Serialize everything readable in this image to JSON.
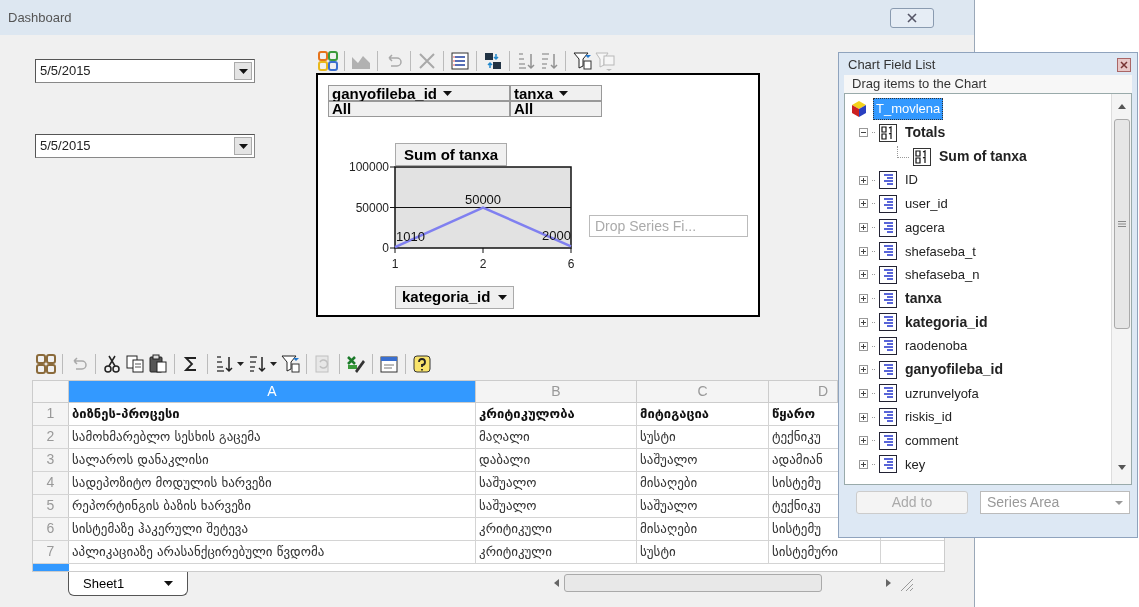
{
  "window": {
    "title": "Dashboard"
  },
  "date_filters": [
    {
      "value": "5/5/2015"
    },
    {
      "value": "5/5/2015"
    }
  ],
  "pivot_chart": {
    "filter_fields": [
      {
        "label": "ganyofileba_id",
        "value": "All"
      },
      {
        "label": "tanxa",
        "value": "All"
      }
    ],
    "drop_zone": {
      "placeholder": "Drop Series Fi..."
    },
    "chart_data": {
      "type": "line",
      "title": "Sum of tanxa",
      "xlabel": "kategoria_id",
      "categories": [
        "1",
        "2",
        "6"
      ],
      "series": [
        {
          "color": "#8080f0",
          "values": [
            1010,
            50000,
            2000
          ]
        }
      ],
      "ylim": [
        0,
        100000
      ],
      "yticks": [
        0,
        50000,
        100000
      ],
      "data_labels": true
    }
  },
  "sheet": {
    "columns": [
      {
        "label": "A",
        "selected": true
      },
      {
        "label": "B",
        "selected": false
      },
      {
        "label": "C",
        "selected": false
      },
      {
        "label": "D",
        "selected": false
      }
    ],
    "rows": [
      {
        "header": "1",
        "bold": true,
        "cells": [
          "ბიზნეს-პროცესი",
          "კრიტიკულობა",
          "მიტიგაცია",
          "წყარო"
        ]
      },
      {
        "header": "2",
        "bold": false,
        "cells": [
          "სამოხმარებლო სესხის გაცემა",
          "მაღალი",
          "სუსტი",
          "ტექნიკუ"
        ]
      },
      {
        "header": "3",
        "bold": false,
        "cells": [
          "სალაროს დანაკლისი",
          "დაბალი",
          "საშუალო",
          "ადამიან"
        ]
      },
      {
        "header": "4",
        "bold": false,
        "cells": [
          "სადეპოზიტო მოდულის ხარვეზი",
          "საშუალო",
          "მისაღები",
          "სისტემუ"
        ]
      },
      {
        "header": "5",
        "bold": false,
        "cells": [
          "რეპორტინგის ბაზის ხარვეზი",
          "საშუალო",
          "საშუალო",
          "ტექნიკუ"
        ]
      },
      {
        "header": "6",
        "bold": false,
        "cells": [
          "სისტემაზე ჰაკერული შეტევა",
          "კრიტიკული",
          "მისაღები",
          "სისტემუ"
        ]
      },
      {
        "header": "7",
        "bold": false,
        "cells": [
          "აპლიკაციაზე არასანქცირებული წვდომა",
          "კრიტიკული",
          "სუსტი",
          "სისტემური"
        ]
      }
    ],
    "tabs": [
      {
        "label": "Sheet1",
        "selected": true
      }
    ]
  },
  "field_list": {
    "title": "Chart Field List",
    "hint": "Drag items to the Chart",
    "root": {
      "label": "T_movlena",
      "selected": true,
      "children": [
        {
          "label": "Totals",
          "kind": "measure",
          "expanded": true,
          "in_use": true,
          "children": [
            {
              "label": "Sum of tanxa",
              "kind": "measure",
              "in_use": true
            }
          ]
        },
        {
          "label": "ID",
          "kind": "field",
          "expanded": false,
          "in_use": false
        },
        {
          "label": "user_id",
          "kind": "field",
          "expanded": false,
          "in_use": false
        },
        {
          "label": "agcera",
          "kind": "field",
          "expanded": false,
          "in_use": false
        },
        {
          "label": "shefaseba_t",
          "kind": "field",
          "expanded": false,
          "in_use": false
        },
        {
          "label": "shefaseba_n",
          "kind": "field",
          "expanded": false,
          "in_use": false
        },
        {
          "label": "tanxa",
          "kind": "field",
          "expanded": false,
          "in_use": true
        },
        {
          "label": "kategoria_id",
          "kind": "field",
          "expanded": false,
          "in_use": true
        },
        {
          "label": "raodenoba",
          "kind": "field",
          "expanded": false,
          "in_use": false
        },
        {
          "label": "ganyofileba_id",
          "kind": "field",
          "expanded": false,
          "in_use": true
        },
        {
          "label": "uzrunvelyofa",
          "kind": "field",
          "expanded": false,
          "in_use": false
        },
        {
          "label": "riskis_id",
          "kind": "field",
          "expanded": false,
          "in_use": false
        },
        {
          "label": "comment",
          "kind": "field",
          "expanded": false,
          "in_use": false
        },
        {
          "label": "key",
          "kind": "field",
          "expanded": false,
          "in_use": false
        }
      ]
    },
    "add_button": {
      "label": "Add to",
      "disabled": true
    },
    "area_select": {
      "value": "Series Area",
      "disabled": true
    }
  }
}
